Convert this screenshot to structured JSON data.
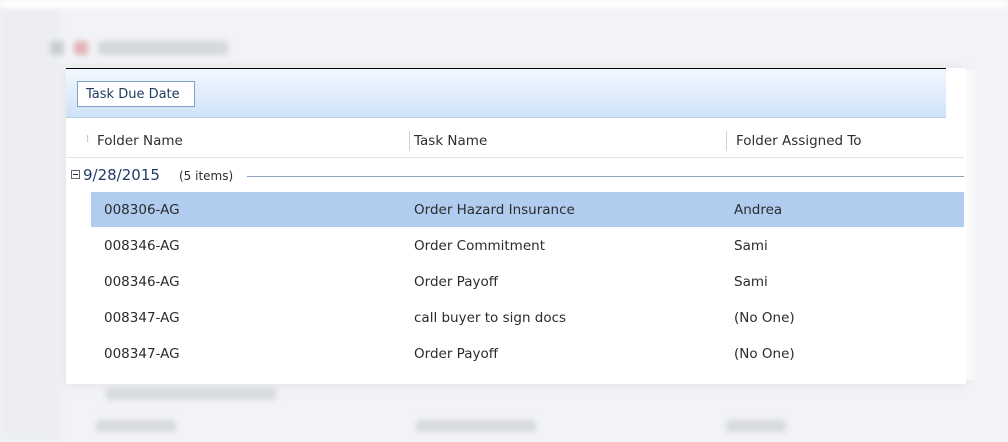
{
  "group_panel": {
    "chip_label": "Task Due Date"
  },
  "columns": [
    {
      "label": "Folder Name"
    },
    {
      "label": "Task Name"
    },
    {
      "label": "Folder Assigned To"
    }
  ],
  "group": {
    "date": "9/28/2015",
    "count": "(5 items)"
  },
  "rows": [
    {
      "folder": "008306-AG",
      "task": "Order Hazard Insurance",
      "assigned": "Andrea",
      "selected": true
    },
    {
      "folder": "008346-AG",
      "task": "Order Commitment",
      "assigned": "Sami",
      "selected": false
    },
    {
      "folder": "008346-AG",
      "task": "Order Payoff",
      "assigned": "Sami",
      "selected": false
    },
    {
      "folder": "008347-AG",
      "task": "call buyer to sign docs",
      "assigned": "(No One)",
      "selected": false
    },
    {
      "folder": "008347-AG",
      "task": "Order Payoff",
      "assigned": "(No One)",
      "selected": false
    }
  ],
  "colors": {
    "selection": "#b0cdf0",
    "group_header_text": "#1f3d66",
    "group_panel_top": "#f3f8ff",
    "group_panel_bottom": "#cfe2f8"
  }
}
